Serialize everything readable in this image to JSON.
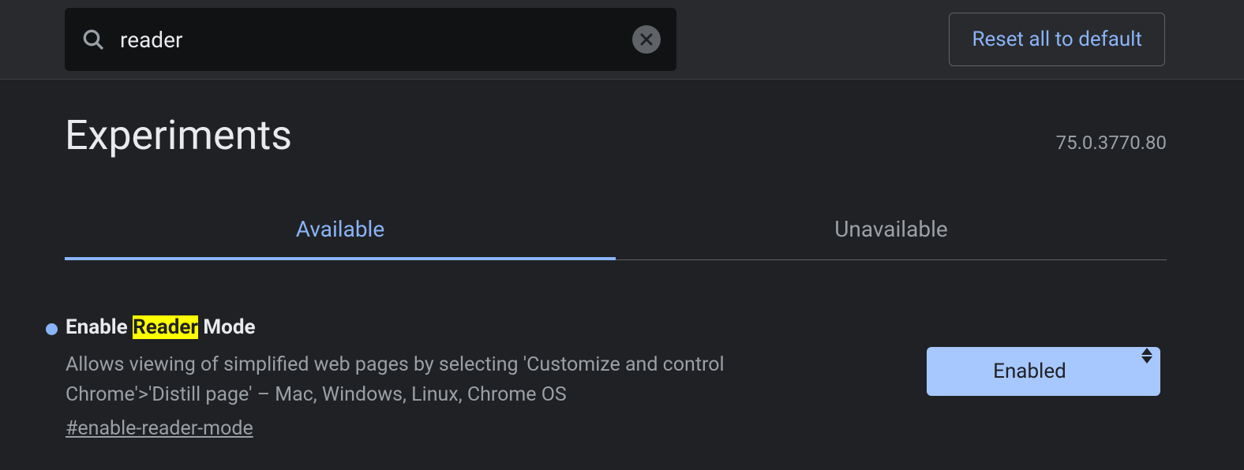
{
  "search": {
    "value": "reader"
  },
  "reset_button_label": "Reset all to default",
  "page_title": "Experiments",
  "version": "75.0.3770.80",
  "tabs": {
    "available": "Available",
    "unavailable": "Unavailable"
  },
  "flag": {
    "title_pre": "Enable ",
    "title_highlight": "Reader",
    "title_post": " Mode",
    "description": "Allows viewing of simplified web pages by selecting 'Customize and control Chrome'>'Distill page' – Mac, Windows, Linux, Chrome OS",
    "hash": "#enable-reader-mode",
    "selected_value": "Enabled",
    "modified": true
  }
}
